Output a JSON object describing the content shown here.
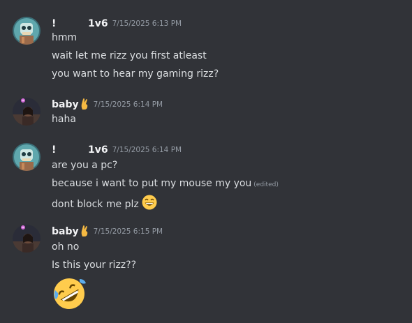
{
  "messages": [
    {
      "author": "!",
      "author_tag": "1v6",
      "timestamp": "7/15/2025 6:13 PM",
      "avatar": "skull-robot-avatar",
      "lines": [
        "hmm",
        "wait let me rizz you first atleast",
        "you want to hear my gaming rizz?"
      ]
    },
    {
      "author": "baby",
      "author_badge": "fingers-crossed-emoji",
      "timestamp": "7/15/2025 6:14 PM",
      "avatar": "girl-night-avatar",
      "lines": [
        "haha"
      ]
    },
    {
      "author": "!",
      "author_tag": "1v6",
      "timestamp": "7/15/2025 6:14 PM",
      "avatar": "skull-robot-avatar",
      "lines": [
        "are you a pc?",
        "because i want to put my mouse my you",
        "dont block me plz"
      ],
      "edited_label": "(edited)",
      "trailing_emoji": "grinning-face-emoji"
    },
    {
      "author": "baby",
      "author_badge": "fingers-crossed-emoji",
      "timestamp": "7/15/2025 6:15 PM",
      "avatar": "girl-night-avatar",
      "lines": [
        "oh no",
        "Is this your rizz??"
      ],
      "big_emoji": "rolling-on-floor-laughing-emoji"
    }
  ],
  "colors": {
    "background": "#313338",
    "username": "#f2f3f5",
    "message_text": "#dbdee1",
    "timestamp": "#949ba4"
  }
}
